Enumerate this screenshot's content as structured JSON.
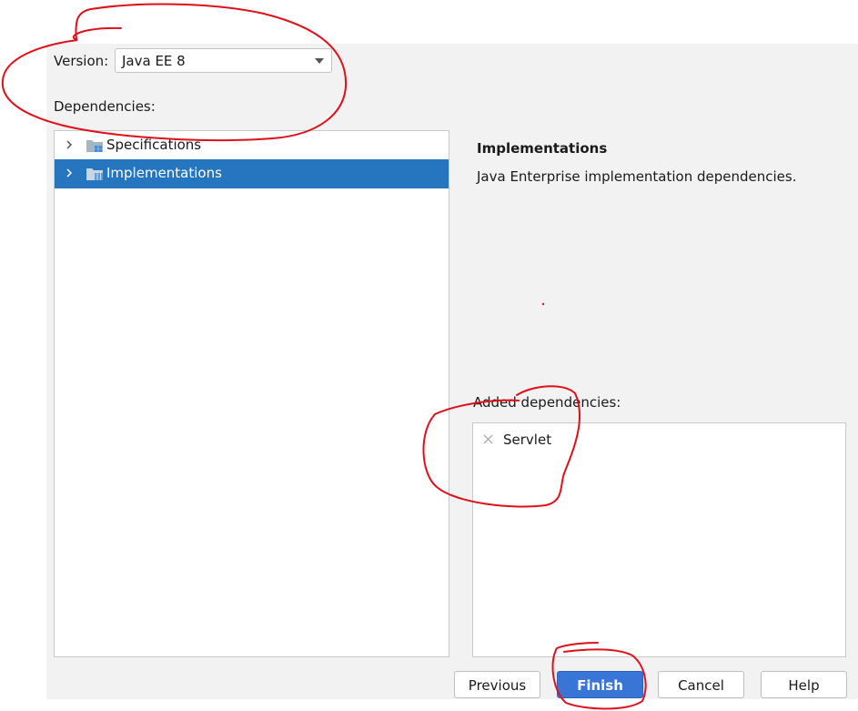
{
  "version": {
    "label": "Version:",
    "value": "Java EE 8"
  },
  "dependencies_label": "Dependencies:",
  "tree": [
    {
      "label": "Specifications",
      "selected": false
    },
    {
      "label": "Implementations",
      "selected": true
    }
  ],
  "description": {
    "title": "Implementations",
    "text": "Java Enterprise implementation dependencies."
  },
  "added": {
    "label": "Added dependencies:",
    "items": [
      "Servlet"
    ]
  },
  "buttons": {
    "previous": "Previous",
    "finish": "Finish",
    "cancel": "Cancel",
    "help": "Help"
  },
  "colors": {
    "selection": "#2675bf",
    "primary_button": "#3875d6",
    "annotation": "#e0101a"
  }
}
